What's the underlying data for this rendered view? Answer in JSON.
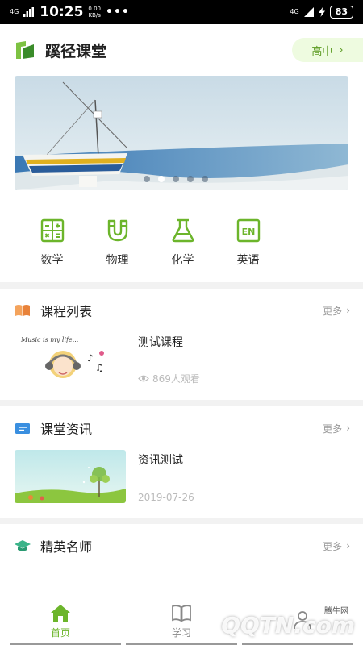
{
  "status": {
    "network": "4G",
    "time": "10:25",
    "speed": "0.00\nKB/s",
    "dots": "•••",
    "net_right": "4G",
    "battery": "83"
  },
  "header": {
    "title": "蹊径课堂",
    "level": "高中"
  },
  "subjects": [
    {
      "label": "数学",
      "icon": "calculator-icon"
    },
    {
      "label": "物理",
      "icon": "magnet-icon"
    },
    {
      "label": "化学",
      "icon": "flask-icon"
    },
    {
      "label": "英语",
      "icon": "en-icon"
    }
  ],
  "sections": {
    "courses": {
      "title": "课程列表",
      "more": "更多",
      "item_title": "测试课程",
      "views": "869人观看",
      "thumb_text": "Music is my life..."
    },
    "news": {
      "title": "课堂资讯",
      "more": "更多",
      "item_title": "资讯测试",
      "date": "2019-07-26"
    },
    "teachers": {
      "title": "精英名师",
      "more": "更多"
    }
  },
  "tabs": [
    {
      "label": "首页",
      "active": true
    },
    {
      "label": "学习",
      "active": false
    },
    {
      "label": "",
      "active": false
    }
  ],
  "watermark": {
    "text": "QQTN.com",
    "small": "腾牛网"
  },
  "colors": {
    "accent": "#6cb52b",
    "accent_bg": "#eefbe0"
  }
}
